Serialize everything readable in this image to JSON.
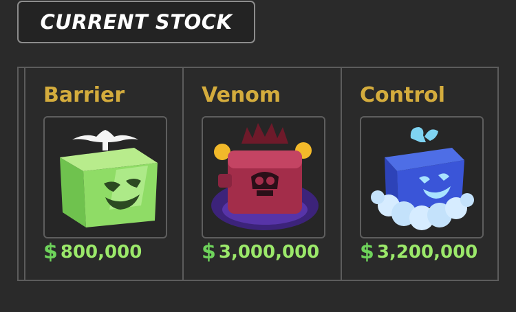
{
  "header": {
    "title": "CURRENT STOCK"
  },
  "stock": [
    {
      "name": "Barrier",
      "price": "800,000",
      "currency_symbol": "$",
      "icon": "barrier-fruit-icon"
    },
    {
      "name": "Venom",
      "price": "3,000,000",
      "currency_symbol": "$",
      "icon": "venom-fruit-icon"
    },
    {
      "name": "Control",
      "price": "3,200,000",
      "currency_symbol": "$",
      "icon": "control-fruit-icon"
    }
  ],
  "colors": {
    "background": "#2a2a2a",
    "name_gold": "#d4ac3d",
    "price_green": "#9be86a",
    "border_gray": "#5c5c5c"
  }
}
